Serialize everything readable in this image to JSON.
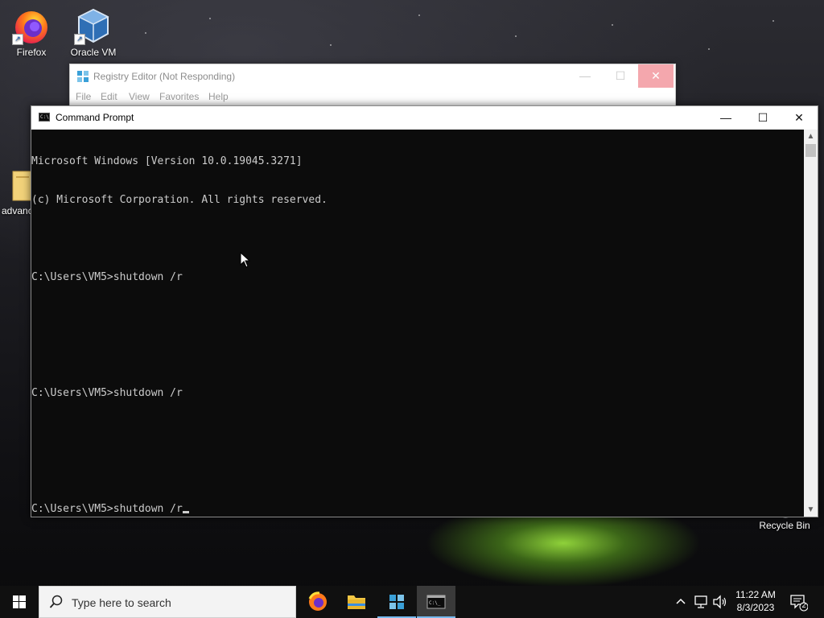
{
  "desktop": {
    "icons": [
      {
        "label": "Firefox"
      },
      {
        "label": "Oracle VM\nVirtualB..."
      },
      {
        "label": "advanc"
      },
      {
        "label": "Recycle Bin"
      }
    ]
  },
  "regedit": {
    "title": "Registry Editor (Not Responding)",
    "menu": [
      "File",
      "Edit",
      "View",
      "Favorites",
      "Help"
    ]
  },
  "cmd": {
    "title": "Command Prompt",
    "lines": [
      "Microsoft Windows [Version 10.0.19045.3271]",
      "(c) Microsoft Corporation. All rights reserved.",
      "",
      "C:\\Users\\VM5>shutdown /r",
      "",
      "",
      "C:\\Users\\VM5>shutdown /r",
      "",
      "",
      "C:\\Users\\VM5>shutdown /r"
    ]
  },
  "taskbar": {
    "search_placeholder": "Type here to search",
    "time": "11:22 AM",
    "date": "8/3/2023",
    "notification_count": "2",
    "apps": [
      "firefox",
      "file-explorer",
      "registry-editor",
      "command-prompt"
    ]
  },
  "colors": {
    "console_bg": "#0c0c0c",
    "console_text": "#cccccc",
    "taskbar_bg": "#101010",
    "active_underline": "#76b9ed"
  }
}
